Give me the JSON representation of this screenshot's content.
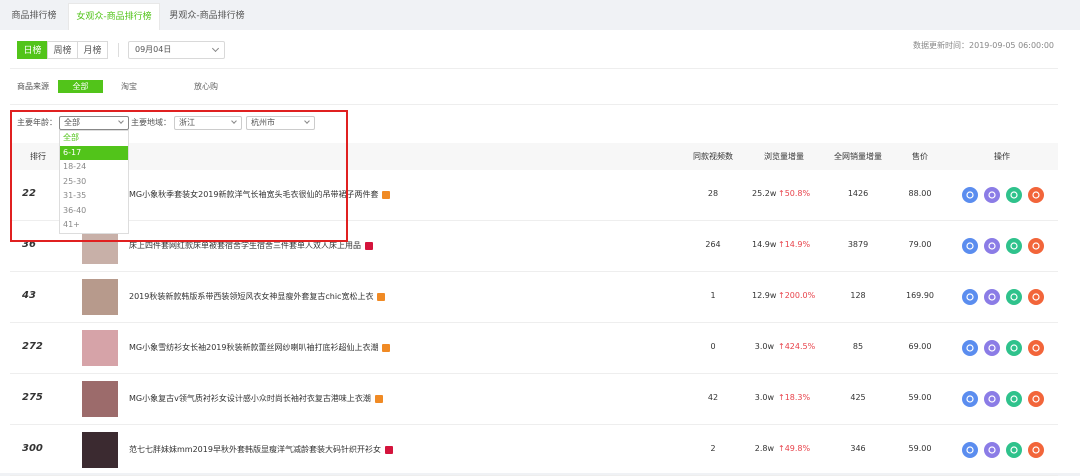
{
  "tabs": [
    "商品排行榜",
    "女观众-商品排行榜",
    "男观众-商品排行榜"
  ],
  "period": {
    "options": [
      "日榜",
      "周榜",
      "月榜"
    ],
    "date": "09月04日"
  },
  "update_time": "数据更新时间：2019-09-05 06:00:00",
  "source": {
    "label": "商品来源",
    "options": [
      "全部",
      "淘宝",
      "放心购"
    ]
  },
  "filters": {
    "age_label": "主要年龄：",
    "age_value": "全部",
    "age_options": [
      "全部",
      "6-17",
      "18-24",
      "25-30",
      "31-35",
      "36-40",
      "41+"
    ],
    "region_label": "主要地域：",
    "province": "浙江",
    "city": "杭州市"
  },
  "table": {
    "headers": [
      "排行",
      "同款视频数",
      "浏览量增量",
      "全网销量增量",
      "售价",
      "操作"
    ],
    "rows": [
      {
        "rank": "22",
        "name": "MG小象秋季套装女2019新款洋气长袖宽头毛衣很仙的吊带裙子两件套",
        "videos": "28",
        "views": "25.2w",
        "rate": "↑50.8%",
        "sales": "1426",
        "price": "88.00",
        "tag_color": "#f08a24"
      },
      {
        "rank": "36",
        "name": "床上四件套网红款床单被套宿舍学生宿舍三件套单人双人床上用品",
        "videos": "264",
        "views": "14.9w",
        "rate": "↑14.9%",
        "sales": "3879",
        "price": "79.00",
        "tag_color": "#d4143c"
      },
      {
        "rank": "43",
        "name": "2019秋装新款韩版系带西装领短风衣女神显瘦外套复古chic宽松上衣",
        "videos": "1",
        "views": "12.9w",
        "rate": "↑200.0%",
        "sales": "128",
        "price": "169.90",
        "tag_color": "#f08a24"
      },
      {
        "rank": "272",
        "name": "MG小象雪纺衫女长袖2019秋装新款蕾丝网纱喇叭袖打底衫超仙上衣潮",
        "videos": "0",
        "views": "3.0w",
        "rate": "↑424.5%",
        "sales": "85",
        "price": "69.00",
        "tag_color": "#f08a24"
      },
      {
        "rank": "275",
        "name": "MG小象复古v领气质衬衫女设计感小众时尚长袖衬衣复古港味上衣潮",
        "videos": "42",
        "views": "3.0w",
        "rate": "↑18.3%",
        "sales": "425",
        "price": "59.00",
        "tag_color": "#f08a24"
      },
      {
        "rank": "300",
        "name": "范七七胖妹妹mm2019早秋外套韩版显瘦洋气减龄套装大码针织开衫女",
        "videos": "2",
        "views": "2.8w",
        "rate": "↑49.8%",
        "sales": "346",
        "price": "59.00",
        "tag_color": "#d4143c"
      }
    ]
  },
  "actions": [
    {
      "icon": "trend-chart-icon",
      "color": "#5b8def"
    },
    {
      "icon": "user-icon",
      "color": "#8b7ce6"
    },
    {
      "icon": "play-video-icon",
      "color": "#2fc28c"
    },
    {
      "icon": "bag-icon",
      "color": "#f2653a"
    }
  ]
}
